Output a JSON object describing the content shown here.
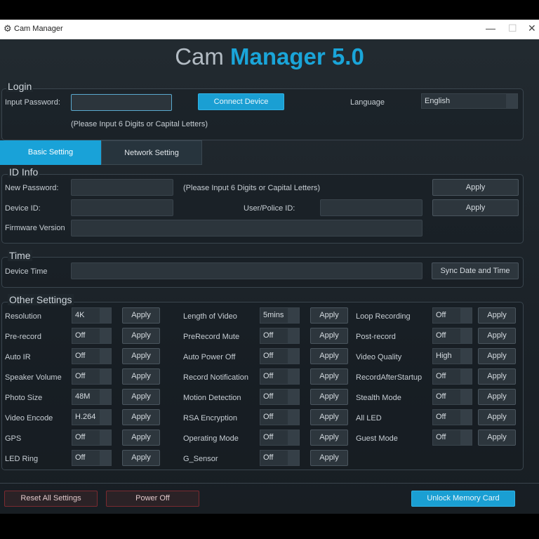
{
  "window": {
    "title": "Cam Manager",
    "minimize": "—",
    "maximize": "☐",
    "close": "✕"
  },
  "app": {
    "title_a": "Cam ",
    "title_b": "Manager 5.0"
  },
  "login": {
    "title": "Login",
    "password_label": "Input Password:",
    "password_value": "",
    "hint": "(Please Input 6 Digits or Capital Letters)",
    "connect_label": "Connect Device",
    "language_label": "Language",
    "language_value": "English"
  },
  "tabs": [
    {
      "label": "Basic Setting",
      "active": true
    },
    {
      "label": "Network Setting",
      "active": false
    }
  ],
  "id_info": {
    "title": "ID Info",
    "new_password_label": "New Password:",
    "hint": "(Please Input 6 Digits or Capital Letters)",
    "device_id_label": "Device ID:",
    "user_id_label": "User/Police ID:",
    "firmware_label": "Firmware Version",
    "apply_label": "Apply"
  },
  "time": {
    "title": "Time",
    "device_time_label": "Device Time",
    "sync_label": "Sync Date and Time"
  },
  "other": {
    "title": "Other Settings",
    "apply_label": "Apply",
    "col1": [
      {
        "label": "Resolution",
        "value": "4K"
      },
      {
        "label": "Pre-record",
        "value": "Off"
      },
      {
        "label": "Auto IR",
        "value": "Off"
      },
      {
        "label": "Speaker Volume",
        "value": "Off"
      },
      {
        "label": "Photo Size",
        "value": "48M"
      },
      {
        "label": "Video Encode",
        "value": "H.264"
      },
      {
        "label": "GPS",
        "value": "Off"
      },
      {
        "label": "LED Ring",
        "value": "Off"
      }
    ],
    "col2": [
      {
        "label": "Length of Video",
        "value": "5mins"
      },
      {
        "label": "PreRecord Mute",
        "value": "Off"
      },
      {
        "label": "Auto Power Off",
        "value": "Off"
      },
      {
        "label": "Record Notification",
        "value": "Off"
      },
      {
        "label": "Motion Detection",
        "value": "Off"
      },
      {
        "label": "RSA Encryption",
        "value": "Off"
      },
      {
        "label": "Operating Mode",
        "value": "Off"
      },
      {
        "label": "G_Sensor",
        "value": "Off"
      }
    ],
    "col3": [
      {
        "label": "Loop Recording",
        "value": "Off"
      },
      {
        "label": "Post-record",
        "value": "Off"
      },
      {
        "label": "Video Quality",
        "value": "High"
      },
      {
        "label": "RecordAfterStartup",
        "value": "Off"
      },
      {
        "label": "Stealth Mode",
        "value": "Off"
      },
      {
        "label": "All LED",
        "value": "Off"
      },
      {
        "label": "Guest Mode",
        "value": "Off"
      }
    ]
  },
  "footer": {
    "reset_label": "Reset All Settings",
    "power_label": "Power Off",
    "unlock_label": "Unlock Memory Card"
  }
}
